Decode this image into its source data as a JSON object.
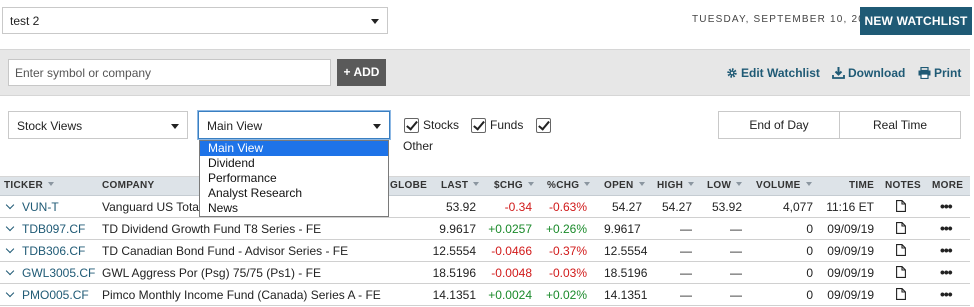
{
  "header": {
    "watchlist_value": "test 2",
    "date": "TUESDAY, SEPTEMBER 10, 2019",
    "new_watchlist_label": "NEW WATCHLIST"
  },
  "addbar": {
    "placeholder": "Enter symbol or company",
    "add_label": "+ ADD",
    "edit_label": "Edit Watchlist",
    "download_label": "Download",
    "print_label": "Print"
  },
  "views": {
    "stock_views_value": "Stock Views",
    "main_view_value": "Main View",
    "stocks_label": "Stocks",
    "funds_label": "Funds",
    "other_label": "Other",
    "end_of_day_label": "End of Day",
    "real_time_label": "Real Time",
    "dropdown_options": [
      "Main View",
      "Dividend",
      "Performance",
      "Analyst Research",
      "News"
    ]
  },
  "columns": {
    "ticker": "TICKER",
    "company": "COMPANY",
    "globe": "GLOBE",
    "last": "LAST",
    "chg": "$CHG",
    "pchg": "%CHG",
    "open": "OPEN",
    "high": "HIGH",
    "low": "LOW",
    "volume": "VOLUME",
    "time": "TIME",
    "notes": "NOTES",
    "more": "MORE"
  },
  "rows": [
    {
      "ticker": "VUN-T",
      "company": "Vanguard US Total M",
      "last": "53.92",
      "chg": "-0.34",
      "pchg": "-0.63%",
      "open": "54.27",
      "high": "54.27",
      "low": "53.92",
      "volume": "4,077",
      "time": "11:16 ET"
    },
    {
      "ticker": "TDB097.CF",
      "company": "TD Dividend Growth Fund T8 Series - FE",
      "last": "9.9617",
      "chg": "+0.0257",
      "pchg": "+0.26%",
      "open": "9.9617",
      "high": "—",
      "low": "—",
      "volume": "0",
      "time": "09/09/19"
    },
    {
      "ticker": "TDB306.CF",
      "company": "TD Canadian Bond Fund - Advisor Series - FE",
      "last": "12.5554",
      "chg": "-0.0466",
      "pchg": "-0.37%",
      "open": "12.5554",
      "high": "—",
      "low": "—",
      "volume": "0",
      "time": "09/09/19"
    },
    {
      "ticker": "GWL3005.CF",
      "company": "GWL Aggress Por (Psg) 75/75 (Ps1) - FE",
      "last": "18.5196",
      "chg": "-0.0048",
      "pchg": "-0.03%",
      "open": "18.5196",
      "high": "—",
      "low": "—",
      "volume": "0",
      "time": "09/09/19"
    },
    {
      "ticker": "PMO005.CF",
      "company": "Pimco Monthly Income Fund (Canada) Series A - FE",
      "last": "14.1351",
      "chg": "+0.0024",
      "pchg": "+0.02%",
      "open": "14.1351",
      "high": "—",
      "low": "—",
      "volume": "0",
      "time": "09/09/19"
    }
  ],
  "more_glyph": "•••",
  "colors": {
    "brand": "#1f5a75",
    "negative": "#d11a1a",
    "positive": "#1a8a2a",
    "dropdown_highlight": "#1e73e8"
  }
}
